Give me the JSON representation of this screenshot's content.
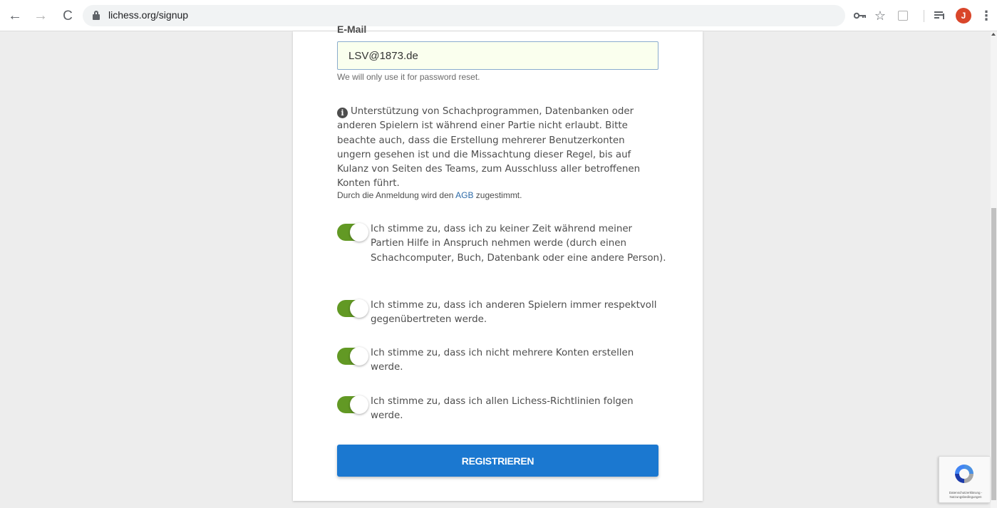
{
  "browser": {
    "url": "lichess.org/signup",
    "back_glyph": "←",
    "forward_glyph": "→",
    "reload_glyph": "C",
    "star_glyph": "☆",
    "key_glyph": "🔑",
    "queue_glyph": "☰",
    "menu_glyph": "⋮",
    "profile_initial": "J",
    "profile_color": "#d9462a",
    "icons": [
      "back-arrow-icon",
      "forward-arrow-icon",
      "reload-icon",
      "lock-icon",
      "key-icon",
      "star-icon",
      "extension-icon",
      "reading-list-icon",
      "kebab-menu-icon"
    ]
  },
  "form": {
    "email_label": "E-Mail",
    "email_value": "LSV@1873.de",
    "email_hint": "We will only use it for password reset.",
    "warning_icon": "i",
    "warning_text": "Unterstützung von Schachprogrammen, Datenbanken oder anderen Spielern ist während einer Partie nicht erlaubt. Bitte beachte auch, dass die Erstellung mehrerer Benutzerkonten ungern gesehen ist und die Missachtung dieser Regel, bis auf Kulanz von Seiten des Teams, zum Ausschluss aller betroffenen Konten führt.",
    "tos_prefix": "Durch die Anmeldung wird den",
    "tos_link": "AGB",
    "tos_suffix": "zugestimmt.",
    "agreements": [
      {
        "text": "Ich stimme zu, dass ich zu keiner Zeit während meiner Partien Hilfe in Anspruch nehmen werde (durch einen Schachcomputer, Buch, Datenbank oder eine andere Person).",
        "checked": true
      },
      {
        "text": "Ich stimme zu, dass ich anderen Spielern immer respektvoll gegenübertreten werde.",
        "checked": true
      },
      {
        "text": "Ich stimme zu, dass ich nicht mehrere Konten erstellen werde.",
        "checked": true
      },
      {
        "text": "Ich stimme zu, dass ich allen Lichess-Richtlinien folgen werde.",
        "checked": true
      }
    ],
    "submit_label": "REGISTRIEREN"
  },
  "recaptcha": {
    "footer_text": "Datenschutzerklärung - Nutzungsbedingungen"
  },
  "colors": {
    "accent": "#1b78d0",
    "toggle_on": "#629924",
    "link": "#2b6aa8",
    "input_bg": "#faffee"
  }
}
